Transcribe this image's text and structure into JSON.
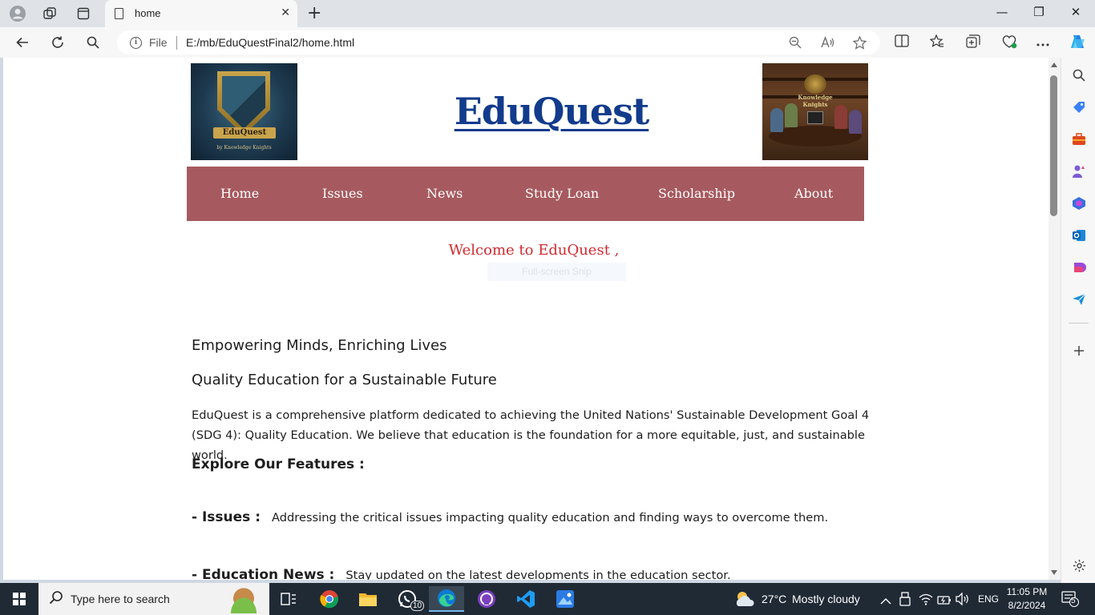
{
  "browser": {
    "tab": {
      "title": "home",
      "close": "✕"
    },
    "new_tab": "+",
    "window_controls": {
      "minimize": "—",
      "restore": "❐",
      "close": "✕"
    },
    "address": {
      "scheme_label": "File",
      "info": "i",
      "url": "E:/mb/EduQuestFinal2/home.html"
    }
  },
  "page": {
    "logo": {
      "ribbon": "EduQuest",
      "tagline": "by Knowledge Knights"
    },
    "site_title": "EduQuest",
    "team_image_text": "Knowledge Knights",
    "nav": [
      "Home",
      "Issues",
      "News",
      "Study Loan",
      "Scholarship",
      "About"
    ],
    "welcome": "Welcome to EduQuest ,",
    "snip_overlay": "Full-screen Snip",
    "tagline_1": "Empowering Minds, Enriching Lives",
    "tagline_2": "Quality Education for a Sustainable Future",
    "intro": "EduQuest is a comprehensive platform dedicated to achieving the United Nations' Sustainable Development Goal 4 (SDG 4): Quality Education. We believe that education is the foundation for a more equitable, just, and sustainable world.",
    "features_heading": "Explore Our Features :",
    "features": [
      {
        "key": "- Issues :",
        "desc": "Addressing the critical issues impacting quality education and finding ways to overcome them."
      },
      {
        "key": "- Education News :",
        "desc": "Stay updated on the latest developments in the education sector."
      }
    ]
  },
  "taskbar": {
    "search_placeholder": "Type here to search",
    "whatsapp_badge": "10",
    "weather": {
      "temp": "27°C",
      "condition": "Mostly cloudy"
    },
    "language": "ENG",
    "time": "11:05 PM",
    "date": "8/2/2024",
    "notification_count": "5"
  },
  "colors": {
    "title": "#123b8c",
    "navbar": "#a65a5f",
    "welcome": "#d02b30",
    "taskbar": "#202a35"
  }
}
